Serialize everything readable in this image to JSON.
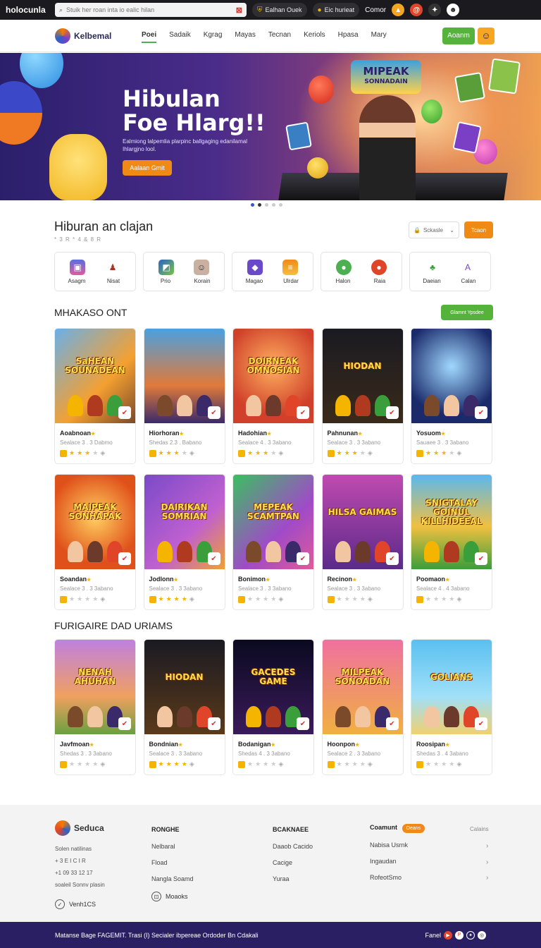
{
  "topbar": {
    "brand": "holocunla",
    "search_placeholder": "Stuik her roan inta io ealic hilan",
    "pill1": "Ealhan Ouek",
    "pill2": "Eic hurieat",
    "link": "Comor"
  },
  "nav": {
    "logo": "Kelbemal",
    "items": [
      "Poei",
      "Sadaik",
      "Kgrag",
      "Mayas",
      "Tecnan",
      "Keriols",
      "Hpasa",
      "Mary"
    ],
    "cta": "Aoanm"
  },
  "hero": {
    "title_line1": "Hibulan",
    "title_line2": "Foe Hlarg!!",
    "subtitle": "Ealmiong lalpemlia plarpinc ballgaging edanilamal Ihlargjno lool.",
    "cta": "Aalaan Gmit",
    "logo_line1": "MIPEAK",
    "logo_line2": "SONNADAIN"
  },
  "section1": {
    "title": "Hiburan an clajan",
    "subtitle": "* 3 R * 4 & 8 R",
    "select": "Sckasle",
    "button": "Tcaon"
  },
  "categories": [
    {
      "labels": [
        "Asagm",
        "Nisat"
      ]
    },
    {
      "labels": [
        "Prio",
        "Korain"
      ]
    },
    {
      "labels": [
        "Magao",
        "Ulrdar"
      ]
    },
    {
      "labels": [
        "Halon",
        "Raia"
      ]
    },
    {
      "labels": [
        "Daeian",
        "Calan"
      ]
    }
  ],
  "section2": {
    "title": "MHAKASO ONT",
    "button": "Glamnt Ypsdee"
  },
  "row1": [
    {
      "thumb_title": "SaHEAN SOUNADEAN",
      "name": "Aoabnoan",
      "meta": "Sealace 3 . 3 Dabmo",
      "stars": 3
    },
    {
      "thumb_title": "",
      "name": "Hiorhoran",
      "meta": "Shedas 2.3 . Babano",
      "stars": 3
    },
    {
      "thumb_title": "DOIRNEAK OMNOSIAN",
      "name": "Hadohian",
      "meta": "Sealace 4 . 3 3abano",
      "stars": 3
    },
    {
      "thumb_title": "HIODAN",
      "name": "Pahnunan",
      "meta": "Sealace 3 . 3 3abano",
      "stars": 3
    },
    {
      "thumb_title": "",
      "name": "Yosuom",
      "meta": "Sauaee 3 . 3 3abano",
      "stars": 3
    }
  ],
  "row2": [
    {
      "thumb_title": "MAIPEAK SONHAPAK",
      "name": "Soandan",
      "meta": "Sealace 3 . 3 3abano",
      "stars": 0
    },
    {
      "thumb_title": "DAIRIKAN SOMRIAN",
      "name": "Jodlonn",
      "meta": "Sealace 3 . 3 3abano",
      "stars": 5
    },
    {
      "thumb_title": "MEPEAK SCAMTPAN",
      "name": "Bonimon",
      "meta": "Sealace 3 . 3 3abano",
      "stars": 0
    },
    {
      "thumb_title": "HILSA GAIMAS",
      "name": "Recinon",
      "meta": "Sealace 3 . 3 3abano",
      "stars": 0
    },
    {
      "thumb_title": "SNIGTALAY GOINUL KILLHIDEEAL",
      "name": "Poomaon",
      "meta": "Sealace 4 . 4 3abano",
      "stars": 0
    }
  ],
  "section3": {
    "title": "FURIGAIRE DAD URIAMS"
  },
  "row3": [
    {
      "thumb_title": "NENAH AHUHAN",
      "name": "Javfmoan",
      "meta": "Shedas 3 . 3 3abano",
      "stars": 0
    },
    {
      "thumb_title": "HIODAN",
      "name": "Bondnian",
      "meta": "Sealace 3 . 3 3abano",
      "stars": 4
    },
    {
      "thumb_title": "GACEDES GAME",
      "name": "Bodanigan",
      "meta": "Shedas 4 . 3 3abano",
      "stars": 0
    },
    {
      "thumb_title": "MILPEAK SONOADAN",
      "name": "Hoonpon",
      "meta": "Sealace 2 . 3 3abano",
      "stars": 0
    },
    {
      "thumb_title": "GOLIANS",
      "name": "Roosipan",
      "meta": "Shedas 3 . 4 3abano",
      "stars": 0
    }
  ],
  "footer": {
    "brand": "Seduca",
    "about": [
      "Solen natilinas",
      "+ 3 E I C I R",
      "+1 09 33 12 17",
      "soaleil Sonnv plasin"
    ],
    "about_btn": "Venh1CS",
    "col1_title": "RONGHE",
    "col1": [
      "Nelbaral",
      "Fload",
      "Nangla Soamd"
    ],
    "col1_btn": "Moaoks",
    "col2_title": "BCAKNAEE",
    "col2": [
      "Daaob Cacido",
      "Cacige",
      "Yuraa"
    ],
    "col3_title": "Coamunt",
    "col3_badge": "Oeans",
    "col3": [
      "Nabisa Usrnk",
      "Ingaudan",
      "RofeotSmo"
    ],
    "col4_title": "Calains"
  },
  "bottombar": {
    "text": "Matanse Bage  FAGEMIT. Trasi (I) Secialer ibpereae Ordoder Bn Cdakali",
    "right": "Fanel"
  },
  "colors": {
    "accent_green": "#55b33b",
    "accent_orange": "#f08a16",
    "footer_bar": "#2b1f63"
  }
}
